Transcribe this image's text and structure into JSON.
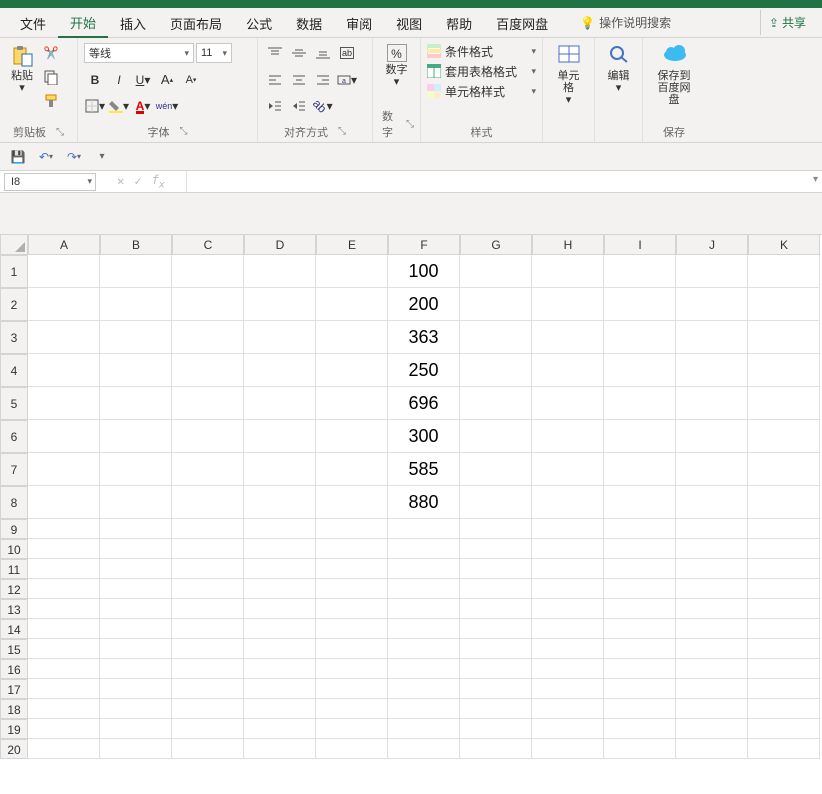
{
  "tabs": {
    "file": "文件",
    "home": "开始",
    "insert": "插入",
    "layout": "页面布局",
    "formula": "公式",
    "data": "数据",
    "review": "审阅",
    "view": "视图",
    "help": "帮助",
    "baidu": "百度网盘",
    "tell_me": "操作说明搜索",
    "share": "共享"
  },
  "groups": {
    "clipboard": {
      "paste": "粘贴",
      "label": "剪贴板"
    },
    "font": {
      "name": "等线",
      "size": "11",
      "label": "字体",
      "wen": "wén"
    },
    "alignment": {
      "label": "对齐方式"
    },
    "number": {
      "btn": "数字",
      "label": "数字"
    },
    "styles": {
      "cond": "条件格式",
      "table": "套用表格格式",
      "cell": "单元格样式",
      "label": "样式"
    },
    "cells": {
      "btn": "单元格",
      "label": ""
    },
    "editing": {
      "btn": "编辑",
      "label": ""
    },
    "save_cloud": {
      "btn_line1": "保存到",
      "btn_line2": "百度网盘",
      "label": "保存"
    }
  },
  "name_box": "I8",
  "formula": "",
  "columns": [
    "A",
    "B",
    "C",
    "D",
    "E",
    "F",
    "G",
    "H",
    "I",
    "J",
    "K"
  ],
  "rows": [
    "1",
    "2",
    "3",
    "4",
    "5",
    "6",
    "7",
    "8",
    "9",
    "10",
    "11",
    "12",
    "13",
    "14",
    "15",
    "16",
    "17",
    "18",
    "19",
    "20"
  ],
  "cells": {
    "F1": "100",
    "F2": "200",
    "F3": "363",
    "F4": "250",
    "F5": "696",
    "F6": "300",
    "F7": "585",
    "F8": "880"
  }
}
